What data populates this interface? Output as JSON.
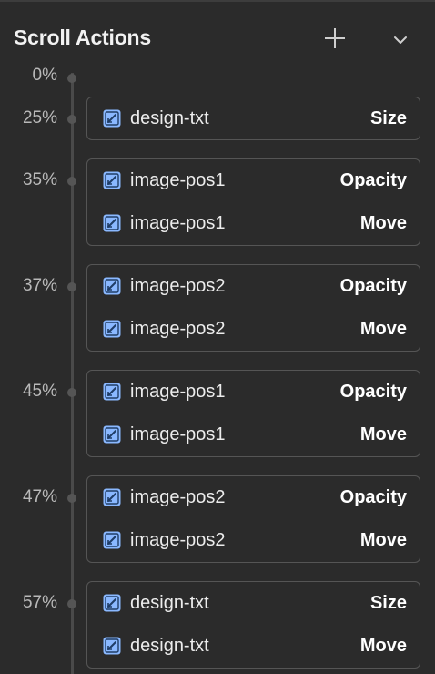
{
  "panel": {
    "title": "Scroll Actions",
    "add_icon": "plus-icon",
    "collapse_icon": "chevron-down-icon",
    "element_icon": "element-icon",
    "accent_color": "#8ab8ff"
  },
  "timeline": {
    "start_label": "0%",
    "groups": [
      {
        "percent": "25%",
        "actions": [
          {
            "element": "design-txt",
            "action": "Size"
          }
        ]
      },
      {
        "percent": "35%",
        "actions": [
          {
            "element": "image-pos1",
            "action": "Opacity"
          },
          {
            "element": "image-pos1",
            "action": "Move"
          }
        ]
      },
      {
        "percent": "37%",
        "actions": [
          {
            "element": "image-pos2",
            "action": "Opacity"
          },
          {
            "element": "image-pos2",
            "action": "Move"
          }
        ]
      },
      {
        "percent": "45%",
        "actions": [
          {
            "element": "image-pos1",
            "action": "Opacity"
          },
          {
            "element": "image-pos1",
            "action": "Move"
          }
        ]
      },
      {
        "percent": "47%",
        "actions": [
          {
            "element": "image-pos2",
            "action": "Opacity"
          },
          {
            "element": "image-pos2",
            "action": "Move"
          }
        ]
      },
      {
        "percent": "57%",
        "actions": [
          {
            "element": "design-txt",
            "action": "Size"
          },
          {
            "element": "design-txt",
            "action": "Move"
          }
        ]
      }
    ]
  }
}
